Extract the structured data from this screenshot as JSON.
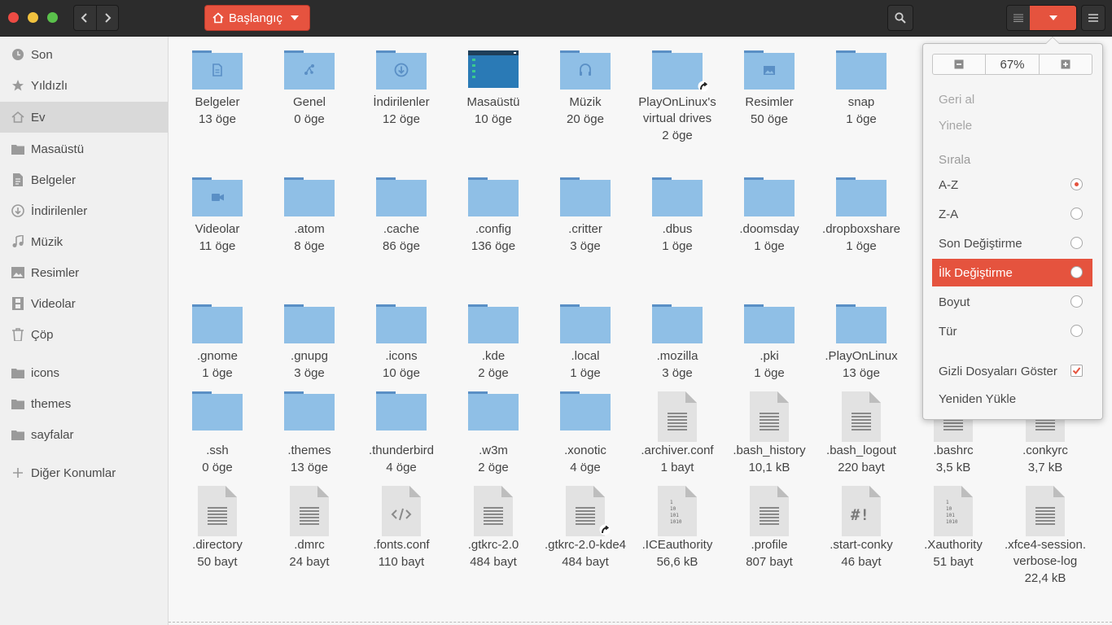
{
  "header": {
    "breadcrumb": "Başlangıç",
    "accent": "#e5533e"
  },
  "sidebar": {
    "items": [
      {
        "label": "Son",
        "icon": "clock-icon"
      },
      {
        "label": "Yıldızlı",
        "icon": "star-icon"
      },
      {
        "label": "Ev",
        "icon": "home-icon",
        "active": true
      },
      {
        "label": "Masaüstü",
        "icon": "folder-icon"
      },
      {
        "label": "Belgeler",
        "icon": "document-icon"
      },
      {
        "label": "İndirilenler",
        "icon": "download-icon"
      },
      {
        "label": "Müzik",
        "icon": "music-icon"
      },
      {
        "label": "Resimler",
        "icon": "image-icon"
      },
      {
        "label": "Videolar",
        "icon": "video-icon"
      },
      {
        "label": "Çöp",
        "icon": "trash-icon"
      },
      {
        "label": "icons",
        "icon": "folder-icon"
      },
      {
        "label": "themes",
        "icon": "folder-icon"
      },
      {
        "label": "sayfalar",
        "icon": "folder-icon"
      },
      {
        "label": "Diğer Konumlar",
        "icon": "plus-icon"
      }
    ]
  },
  "files": [
    {
      "name": "Belgeler",
      "meta": "13 öge",
      "kind": "folder",
      "badge": "document"
    },
    {
      "name": "Genel",
      "meta": "0 öge",
      "kind": "folder",
      "badge": "share"
    },
    {
      "name": "İndirilenler",
      "meta": "12 öge",
      "kind": "folder",
      "badge": "download"
    },
    {
      "name": "Masaüstü",
      "meta": "10 öge",
      "kind": "desktop"
    },
    {
      "name": "Müzik",
      "meta": "20 öge",
      "kind": "folder",
      "badge": "music"
    },
    {
      "name": "PlayOnLinux's virtual drives",
      "meta": "2 öge",
      "kind": "folder",
      "link": true
    },
    {
      "name": "Resimler",
      "meta": "50 öge",
      "kind": "folder",
      "badge": "image"
    },
    {
      "name": "snap",
      "meta": "1 öge",
      "kind": "folder"
    },
    {
      "name": "Videolar",
      "meta": "11 öge",
      "kind": "folder",
      "badge": "video"
    },
    {
      "name": ".atom",
      "meta": "8 öge",
      "kind": "folder"
    },
    {
      "name": ".cache",
      "meta": "86 öge",
      "kind": "folder"
    },
    {
      "name": ".config",
      "meta": "136 öge",
      "kind": "folder"
    },
    {
      "name": ".critter",
      "meta": "3 öge",
      "kind": "folder"
    },
    {
      "name": ".dbus",
      "meta": "1 öge",
      "kind": "folder"
    },
    {
      "name": ".doomsday",
      "meta": "1 öge",
      "kind": "folder"
    },
    {
      "name": ".dropboxshare",
      "meta": "1 öge",
      "kind": "folder"
    },
    {
      "name": ".gnome",
      "meta": "1 öge",
      "kind": "folder"
    },
    {
      "name": ".gnupg",
      "meta": "3 öge",
      "kind": "folder"
    },
    {
      "name": ".icons",
      "meta": "10 öge",
      "kind": "folder"
    },
    {
      "name": ".kde",
      "meta": "2 öge",
      "kind": "folder"
    },
    {
      "name": ".local",
      "meta": "1 öge",
      "kind": "folder"
    },
    {
      "name": ".mozilla",
      "meta": "3 öge",
      "kind": "folder"
    },
    {
      "name": ".pki",
      "meta": "1 öge",
      "kind": "folder"
    },
    {
      "name": ".PlayOnLinux",
      "meta": "13 öge",
      "kind": "folder"
    },
    {
      "name": ".ssh",
      "meta": "0 öge",
      "kind": "folder"
    },
    {
      "name": ".themes",
      "meta": "13 öge",
      "kind": "folder"
    },
    {
      "name": ".thunderbird",
      "meta": "4 öge",
      "kind": "folder"
    },
    {
      "name": ".w3m",
      "meta": "2 öge",
      "kind": "folder"
    },
    {
      "name": ".xonotic",
      "meta": "4 öge",
      "kind": "folder"
    },
    {
      "name": ".archiver.conf",
      "meta": "1 bayt",
      "kind": "text"
    },
    {
      "name": ".bash_history",
      "meta": "10,1 kB",
      "kind": "text"
    },
    {
      "name": ".bash_logout",
      "meta": "220 bayt",
      "kind": "text"
    },
    {
      "name": ".bashrc",
      "meta": "3,5 kB",
      "kind": "text"
    },
    {
      "name": ".conkyrc",
      "meta": "3,7 kB",
      "kind": "text"
    },
    {
      "name": ".directory",
      "meta": "50 bayt",
      "kind": "text"
    },
    {
      "name": ".dmrc",
      "meta": "24 bayt",
      "kind": "text"
    },
    {
      "name": ".fonts.conf",
      "meta": "110 bayt",
      "kind": "code"
    },
    {
      "name": ".gtkrc-2.0",
      "meta": "484 bayt",
      "kind": "text"
    },
    {
      "name": ".gtkrc-2.0-kde4",
      "meta": "484 bayt",
      "kind": "text",
      "link": true
    },
    {
      "name": ".ICEauthority",
      "meta": "56,6 kB",
      "kind": "binary"
    },
    {
      "name": ".profile",
      "meta": "807 bayt",
      "kind": "text"
    },
    {
      "name": ".start-conky",
      "meta": "46 bayt",
      "kind": "script"
    },
    {
      "name": ".Xauthority",
      "meta": "51 bayt",
      "kind": "binary"
    },
    {
      "name": ".xfce4-session.verbose-log",
      "meta": "22,4 kB",
      "kind": "text"
    }
  ],
  "popover": {
    "zoom": "67%",
    "undo": "Geri al",
    "redo": "Yinele",
    "sort_header": "Sırala",
    "sort_options": [
      {
        "label": "A-Z",
        "checked": true
      },
      {
        "label": "Z-A",
        "checked": false
      },
      {
        "label": "Son Değiştirme",
        "checked": false
      },
      {
        "label": "İlk Değiştirme",
        "checked": false,
        "highlighted": true
      },
      {
        "label": "Boyut",
        "checked": false
      },
      {
        "label": "Tür",
        "checked": false
      }
    ],
    "show_hidden": "Gizli Dosyaları Göster",
    "show_hidden_checked": true,
    "reload": "Yeniden Yükle"
  }
}
